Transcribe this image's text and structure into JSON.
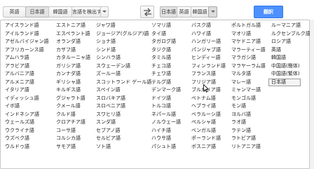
{
  "toolbar": {
    "source_langs": [
      "英語",
      "日本語",
      "韓国語",
      "言語を検出する"
    ],
    "target_langs": [
      "日本語",
      "英語",
      "韓国語"
    ],
    "translate_label": "翻訳",
    "icons": {
      "swap": "swap-arrows-icon",
      "dropdown": "caret-down-icon"
    }
  },
  "language_menu": {
    "columns": [
      [
        "アイスランド語",
        "アイルランド語",
        "アゼルバイジャン語",
        "アフリカーンス語",
        "アムハラ語",
        "アラビア語",
        "アルバニア語",
        "アルメニア語",
        "イタリア語",
        "イディッシュ語",
        "イボ語",
        "インドネシア語",
        "ウェールズ語",
        "ウクライナ語",
        "ウズベク語",
        "ウルドゥ語"
      ],
      [
        "エストニア語",
        "エスペラント語",
        "オランダ語",
        "カザフ語",
        "カタルーニャ語",
        "ガリシア語",
        "カンナダ語",
        "ギリシャ語",
        "キルギス語",
        "グジャラト語",
        "クメール語",
        "クルド語",
        "クロアチア語",
        "コーサ語",
        "コルシカ語",
        "サモア語"
      ],
      [
        "ジャワ語",
        "ジョージア(グルジア)語",
        "ショナ語",
        "シンド語",
        "シンハラ語",
        "スウェーデン語",
        "ズールー語",
        "スコットランド ゲール語",
        "スペイン語",
        "スロバキア語",
        "スロベニア語",
        "スワヒリ語",
        "スンダ語",
        "セブアノ語",
        "セルビア語",
        "ソト語"
      ],
      [
        "ソマリ語",
        "タイ語",
        "タガログ語",
        "タジク語",
        "タミル語",
        "チェコ語",
        "チェワ語",
        "テルグ語",
        "デンマーク語",
        "ドイツ語",
        "トルコ語",
        "ネパール語",
        "ノルウェー語",
        "ハイチ語",
        "ハウサ語",
        "パシュト語"
      ],
      [
        "バスク語",
        "ハワイ語",
        "ハンガリー語",
        "パンジャブ語",
        "ヒンディー語",
        "フィンランド語",
        "フランス語",
        "フリジア語",
        "ブルガリア語",
        "ベトナム語",
        "ヘブライ語",
        "ベラルーシ語",
        "ペルシャ語",
        "ベンガル語",
        "ポーランド語",
        "ボスニア語"
      ],
      [
        "ポルトガル語",
        "マオリ語",
        "マケドニア語",
        "マラーティー語",
        "マラガシ語",
        "マラヤーラム語",
        "マルタ語",
        "マレー語",
        "ミャンマー語",
        "モンゴル語",
        "モン語",
        "ヨルバ語",
        "ラオ語",
        "ラテン語",
        "ラトビア語",
        "リトアニア語"
      ],
      [
        "ルーマニア語",
        "ルクセンブルク語",
        "ロシア語",
        "英語",
        "韓国語",
        "中国語(簡体)",
        "中国語(繁体)",
        "日本語"
      ]
    ],
    "selected": "日本語"
  }
}
